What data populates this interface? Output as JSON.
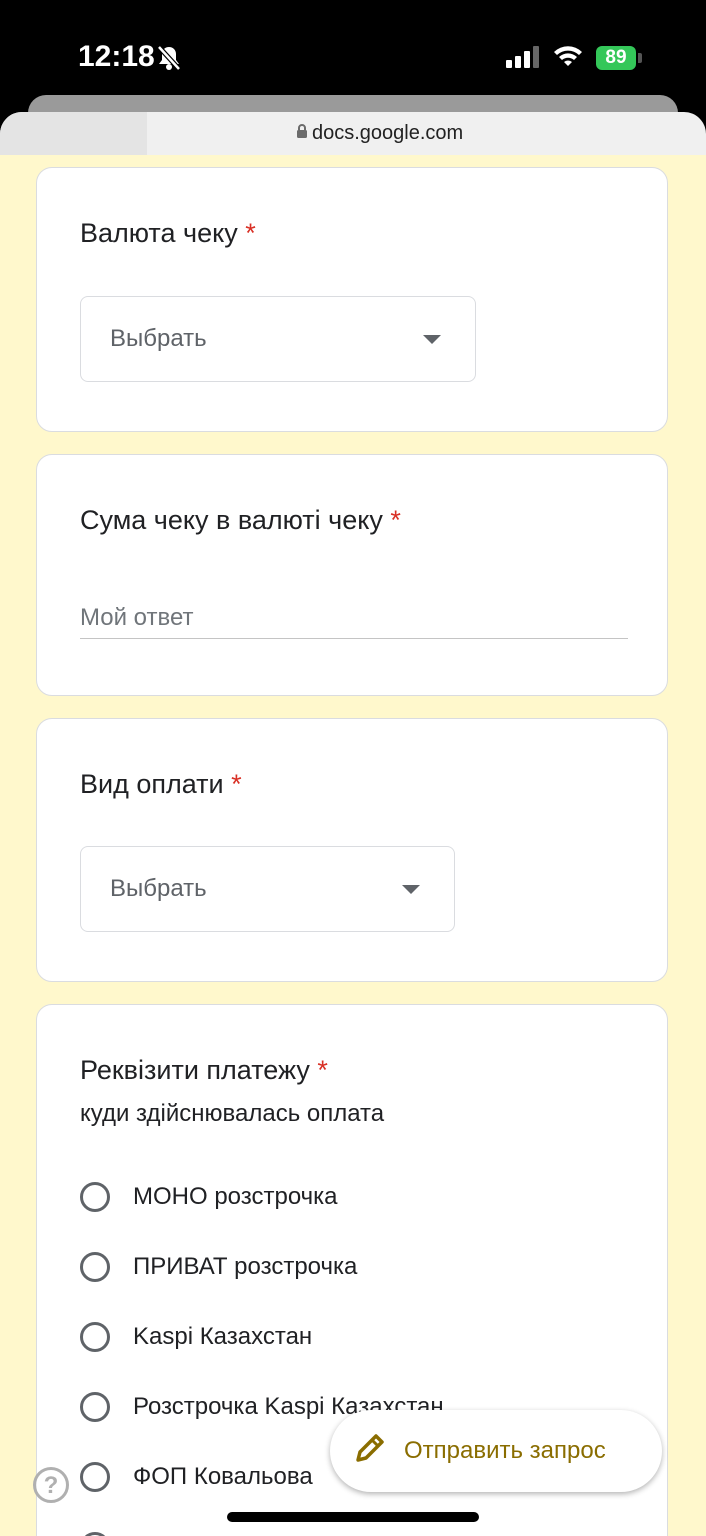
{
  "status_bar": {
    "time": "12:18",
    "battery": "89"
  },
  "browser": {
    "url": "docs.google.com"
  },
  "form": {
    "currency_question": {
      "title": "Валюта чеку",
      "required_mark": "*",
      "select_value": "Выбрать"
    },
    "amount_question": {
      "title": "Сума чеку в валюті чеку",
      "required_mark": "*",
      "placeholder": "Мой ответ"
    },
    "payment_type_question": {
      "title": "Вид оплати",
      "required_mark": "*",
      "select_value": "Выбрать"
    },
    "payment_details_question": {
      "title": "Реквізити платежу",
      "required_mark": "*",
      "description": "куди здійснювалась оплата",
      "options": [
        "МОНО розстрочка",
        "ПРИВАТ розстрочка",
        "Kaspi Казахстан",
        "Розстрочка Kaspi Казахстан",
        "ФОП Ковальова"
      ]
    }
  },
  "fab": {
    "label": "Отправить запрос",
    "icon": "pencil-icon"
  },
  "help": {
    "label": "?",
    "icon": "help-icon"
  },
  "colors": {
    "page_background": "#fff8cc",
    "required": "#d93025",
    "fab_text": "#8a6d00",
    "battery": "#34c759"
  }
}
